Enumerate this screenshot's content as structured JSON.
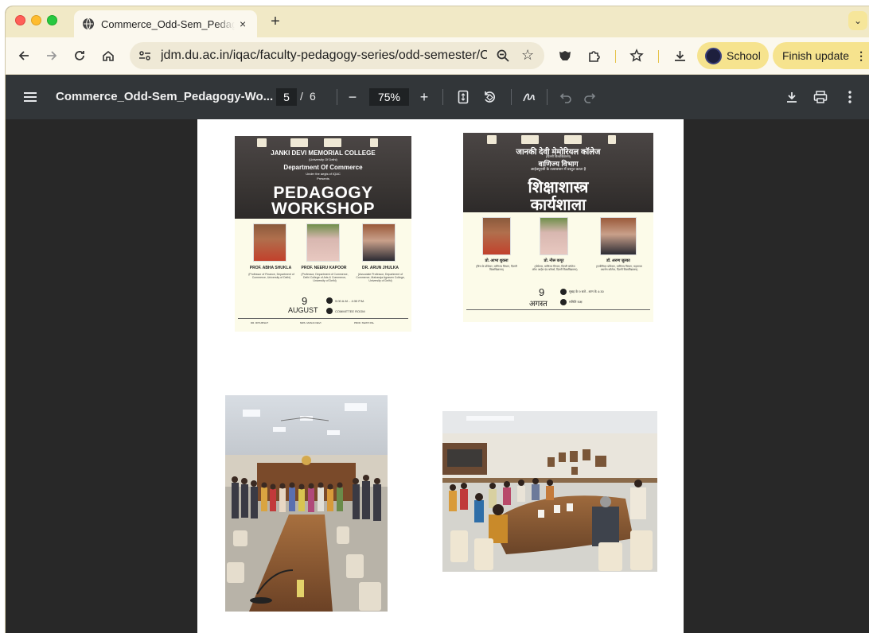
{
  "tab": {
    "title": "Commerce_Odd-Sem_Pedagogy-Workshop",
    "close": "×",
    "new_tab": "+",
    "menu": "⌄"
  },
  "toolbar": {
    "url": "jdm.du.ac.in/iqac/faculty-pedagogy-series/odd-semester/C...",
    "profile_label": "School",
    "update_label": "Finish update",
    "update_menu": "⋮"
  },
  "pdf": {
    "title": "Commerce_Odd-Sem_Pedagogy-Wo...",
    "current_page": "5",
    "page_sep": "/",
    "total_pages": "6",
    "zoom": "75%",
    "zoom_out": "−",
    "zoom_in": "+"
  },
  "poster_en": {
    "college": "JANKI DEVI MEMORIAL COLLEGE",
    "univ": "(University Of Delhi)",
    "dept": "Department Of Commerce",
    "aegis": "Under the aegis of IQAC",
    "presents": "Presents",
    "line1": "PEDAGOGY",
    "line2": "WORKSHOP",
    "speakers": [
      {
        "name": "PROF. ABHA SHUKLA",
        "desc": "(Professor of Finance, Department of Commerce, University of Delhi)"
      },
      {
        "name": "PROF. NEERU KAPOOR",
        "desc": "(Professor, Department of Commerce, Delhi College of Arts & Commerce, University of Delhi)"
      },
      {
        "name": "DR. ARUN JHULKA",
        "desc": "(Associate Professor, Department of Commerce, Maharaja Agrasen College, University of Delhi)"
      }
    ],
    "day": "9",
    "month": "AUGUST",
    "time": "9:00 A.M. - 4:30 P.M.",
    "venue": "COMMITTEE ROOM",
    "footer": [
      "DR. RITA BISHT",
      "MRS. MANJU DEVI",
      "PROF. SWATI PAL"
    ]
  },
  "poster_hi": {
    "college": "जानकी देवी मेमोरियल कॉलेज",
    "univ": "(दिल्ली विश्वविद्यालय)",
    "dept": "वाणिज्य विभाग",
    "aegis": "आईक्यूएसी के तत्वावधान में प्रस्तुत करता है",
    "line1": "शिक्षाशास्त्र",
    "line2": "कार्यशाला",
    "speakers": [
      {
        "name": "प्रो. आभा शुक्ला",
        "desc": "(वित्त के प्रोफेसर, वाणिज्य विभाग, दिल्ली विश्वविद्यालय)"
      },
      {
        "name": "प्रो. नीरू कपूर",
        "desc": "(प्रोफेसर, वाणिज्य विभाग, दिल्ली कॉलेज ऑफ आर्ट्स एंड कॉमर्स, दिल्ली विश्वविद्यालय)"
      },
      {
        "name": "डॉ. अरुण जुल्का",
        "desc": "(एसोसिएट प्रोफेसर, वाणिज्य विभाग, महाराजा अग्रसेन कॉलेज, दिल्ली विश्वविद्यालय)"
      }
    ],
    "day": "9",
    "month": "अगस्त",
    "time": "सुबह के 9 बजे - शाम के 4:30",
    "venue": "समिति कक्ष"
  },
  "colors": {
    "window_bg": "#323639",
    "tab_strip": "#f1e9c6",
    "profile_pill": "#f6e38e",
    "pdf_viewer_bg": "#282828"
  }
}
